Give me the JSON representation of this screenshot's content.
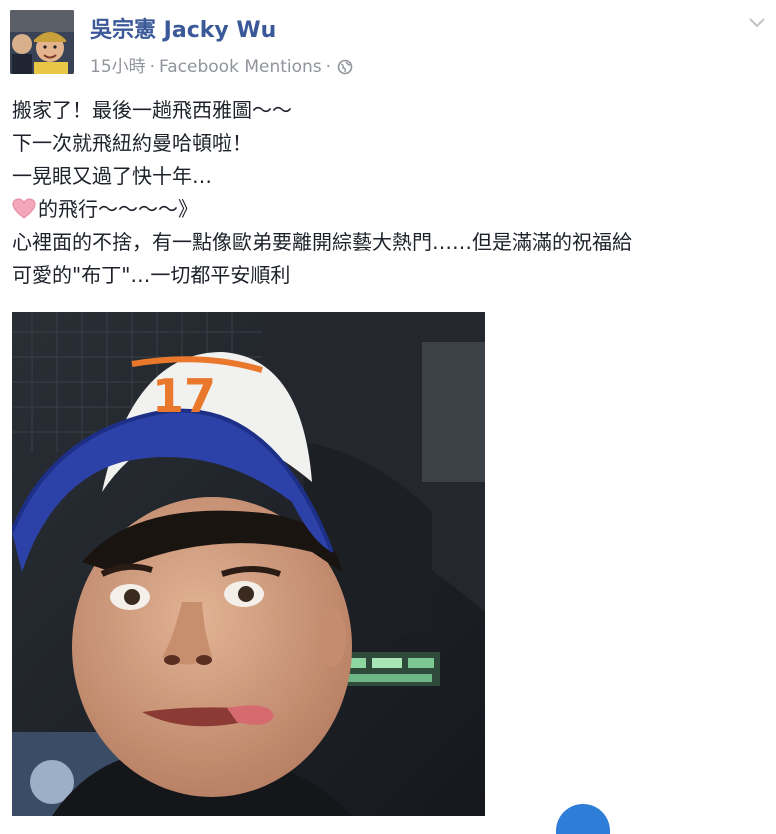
{
  "post": {
    "author": "吳宗憲 Jacky Wu",
    "meta": {
      "time": "15小時",
      "source": "Facebook Mentions",
      "sep": "·"
    },
    "text_lines": [
      "搬家了！最後一趟飛西雅圖～～",
      "下一次就飛紐約曼哈頓啦！",
      "一晃眼又過了快十年…",
      "的飛行～～～～》",
      "心裡面的不捨，有一點像歐弟要離開綜藝大熱門……但是滿滿的祝福給",
      "可愛的\"布丁\"…一切都平安順利"
    ],
    "photo": {
      "cap_text": "17"
    }
  },
  "colors": {
    "author_link": "#3b5998",
    "meta_gray": "#90949c",
    "heart": "#f4a7b9"
  },
  "icons": [
    "globe-icon",
    "chevron-down-icon",
    "heart-icon"
  ]
}
